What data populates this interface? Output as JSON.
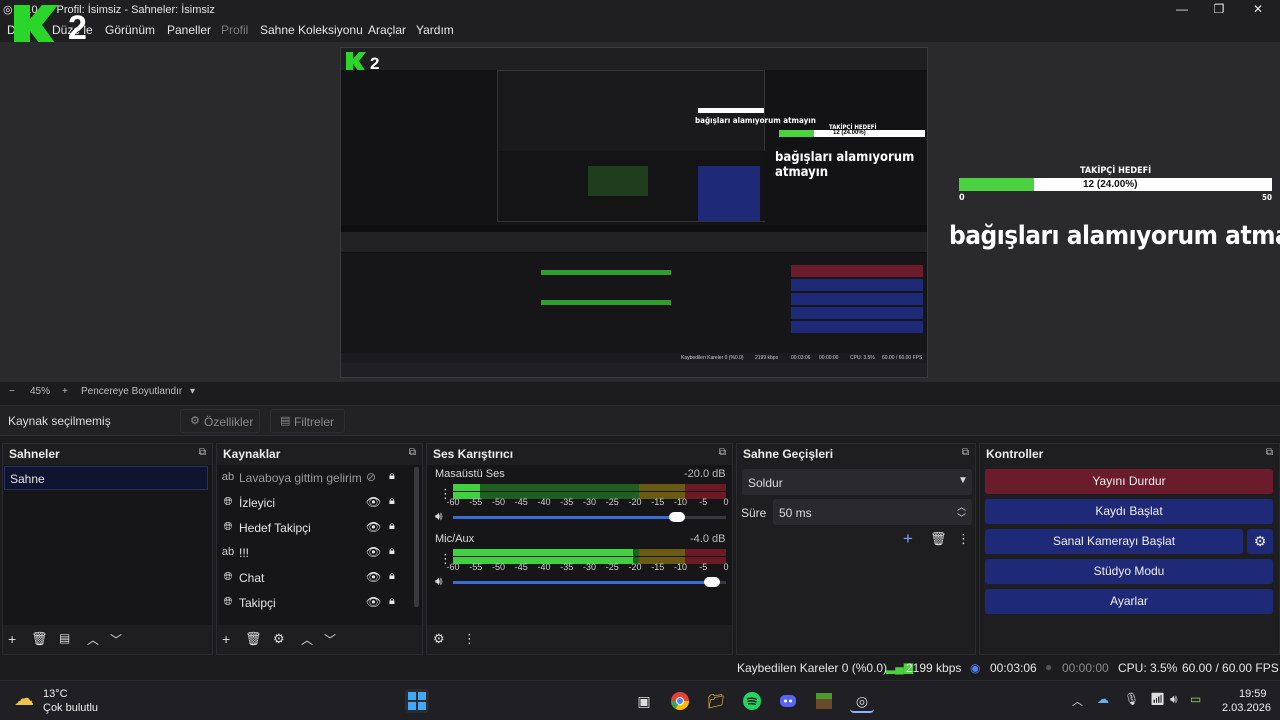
{
  "window": {
    "title": "OBS 32.0.4 - Profil: İsimsiz - Sahneler: İsimsiz",
    "title_visible": "B .0.4 - Profil: İsimsiz - Sahneler: İsimsiz",
    "controls": [
      "—",
      "❐",
      "✕"
    ]
  },
  "logo": {
    "text": "K2",
    "mark_color": "#2bd62b"
  },
  "menu": {
    "items": [
      "Dosya",
      "Düzenle",
      "Görünüm",
      "Paneller",
      "Profil",
      "Sahne Koleksiyonu",
      "Araçlar",
      "Yardım"
    ],
    "visible": [
      "D",
      "Düze le",
      "Görünüm",
      "Paneller",
      "Profil",
      "Sahne Koleksiyonu",
      "Araçlar",
      "Yardım"
    ]
  },
  "overlay": {
    "goal_title": "TAKİPÇİ HEDEFİ",
    "goal_value": "12 (24.00%)",
    "goal_progress": 0.24,
    "goal_min": "0",
    "goal_max": "50",
    "banner": "bağışları alamıyorum atmayın",
    "bar_color": "#4cd140"
  },
  "nested": {
    "goal_title": "TAKİPÇİ HEDEFİ",
    "goal_value": "12 (24.00%)",
    "banner": "bağışları alamıyorum atmayın",
    "banner2": "bağışları alamıyorum atmayın"
  },
  "zoom": {
    "minus": "−",
    "value": "45%",
    "plus": "+",
    "mode": "Pencereye Boyutlandır",
    "chevron": "▾"
  },
  "source_bar": {
    "status": "Kaynak seçilmemiş",
    "properties": "Özellikler",
    "filters": "Filtreler"
  },
  "scenes": {
    "title": "Sahneler",
    "items": [
      "Sahne"
    ]
  },
  "sources": {
    "title": "Kaynaklar",
    "items": [
      {
        "name": "Lavaboya gittim gelirim s",
        "icon": "text",
        "hidden": true
      },
      {
        "name": "İzleyici",
        "icon": "browser",
        "hidden": false
      },
      {
        "name": "Hedef Takipçi",
        "icon": "browser",
        "hidden": false
      },
      {
        "name": "!!!",
        "icon": "text",
        "hidden": false
      },
      {
        "name": "Chat",
        "icon": "browser",
        "hidden": false
      },
      {
        "name": "Takipçi",
        "icon": "browser",
        "hidden": false
      }
    ]
  },
  "mixer": {
    "title": "Ses Karıştırıcı",
    "channels": [
      {
        "name": "Masaüstü Ses",
        "db": "-20.0 dB",
        "volume": 0.82,
        "level": 0.1
      },
      {
        "name": "Mic/Aux",
        "db": "-4.0 dB",
        "volume": 0.95,
        "level": 0.66
      }
    ],
    "scale": [
      "-60",
      "-55",
      "-50",
      "-45",
      "-40",
      "-35",
      "-30",
      "-25",
      "-20",
      "-15",
      "-10",
      "-5",
      "0"
    ]
  },
  "transitions": {
    "title": "Sahne Geçişleri",
    "selected": "Soldur",
    "duration_label": "Süre",
    "duration": "50 ms"
  },
  "controls": {
    "title": "Kontroller",
    "stop_stream": "Yayını Durdur",
    "start_record": "Kaydı Başlat",
    "virtual_cam": "Sanal Kamerayı Başlat",
    "studio_mode": "Stüdyo Modu",
    "settings": "Ayarlar",
    "stop_color": "#6a1c2c",
    "btn_color": "#1e2a78"
  },
  "status": {
    "dropped": "Kaybedilen Kareler 0 (%0.0)",
    "bitrate": "2199 kbps",
    "stream_time": "00:03:06",
    "rec_time": "00:00:00",
    "cpu": "CPU: 3.5%",
    "fps": "60.00 / 60.00 FPS"
  },
  "nested_status": {
    "dropped": "Kaybedilen Kareler 0 (%0.0)",
    "bitrate": "2199 kbps",
    "stream_time": "00:03:06",
    "rec_time": "00:00:00",
    "cpu": "CPU: 3.5%",
    "fps": "60.00 / 60.00 FPS"
  },
  "taskbar": {
    "weather_temp": "13°C",
    "weather_desc": "Çok bulutlu",
    "time": "19:59",
    "date": "2.03.2026"
  }
}
